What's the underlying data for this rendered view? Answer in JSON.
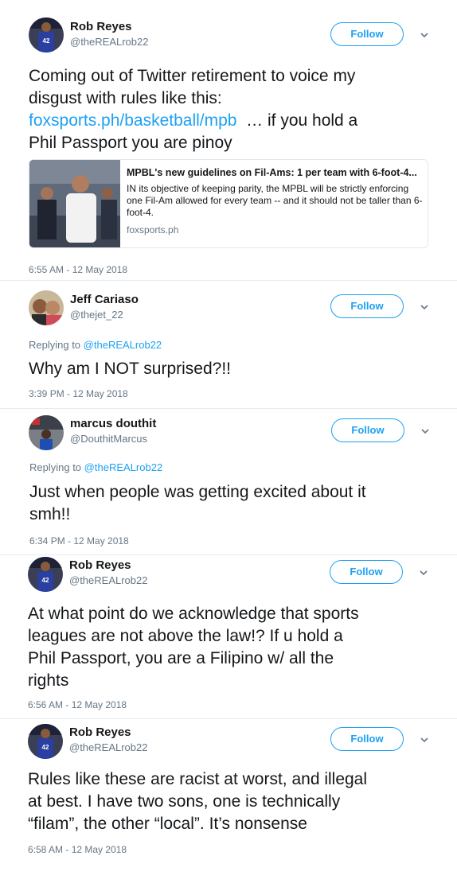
{
  "follow_label": "Follow",
  "replying_prefix": "Replying to",
  "tweets": [
    {
      "name": "Rob Reyes",
      "handle": "@theREALrob22",
      "lines": [
        "Coming out of Twitter retirement to voice my",
        "disgust with rules like this:"
      ],
      "link": "foxsports.ph/basketball/mpb",
      "link_suffix": "  … if you hold a",
      "last_line": "Phil Passport you are pinoy",
      "card": {
        "title": "MPBL's new guidelines on Fil-Ams: 1 per team with 6-foot-4...",
        "description": "IN its objective of keeping parity, the MPBL will be strictly enforcing one Fil-Am allowed for every team -- and it should not be taller than 6-foot-4.",
        "domain": "foxsports.ph"
      },
      "timestamp": "6:55 AM - 12 May 2018"
    },
    {
      "name": "Jeff Cariaso",
      "handle": "@thejet_22",
      "reply_to": "@theREALrob22",
      "lines": [
        "Why am I NOT surprised?!!"
      ],
      "timestamp": "3:39 PM - 12 May 2018"
    },
    {
      "name": "marcus douthit",
      "handle": "@DouthitMarcus",
      "reply_to": "@theREALrob22",
      "lines": [
        "Just when people was getting excited about it",
        "smh!!"
      ],
      "timestamp": "6:34 PM - 12 May 2018"
    },
    {
      "name": "Rob Reyes",
      "handle": "@theREALrob22",
      "lines": [
        "At what point do we acknowledge that sports",
        "leagues are not above the law!? If u hold a",
        "Phil Passport, you are a Filipino w/ all the",
        "rights"
      ],
      "timestamp": "6:56 AM - 12 May 2018"
    },
    {
      "name": "Rob Reyes",
      "handle": "@theREALrob22",
      "lines": [
        "Rules like these are racist at worst, and illegal",
        "at best. I have two sons, one is technically",
        "“filam”, the other “local”. It’s nonsense"
      ],
      "timestamp": "6:58 AM - 12 May 2018"
    }
  ]
}
